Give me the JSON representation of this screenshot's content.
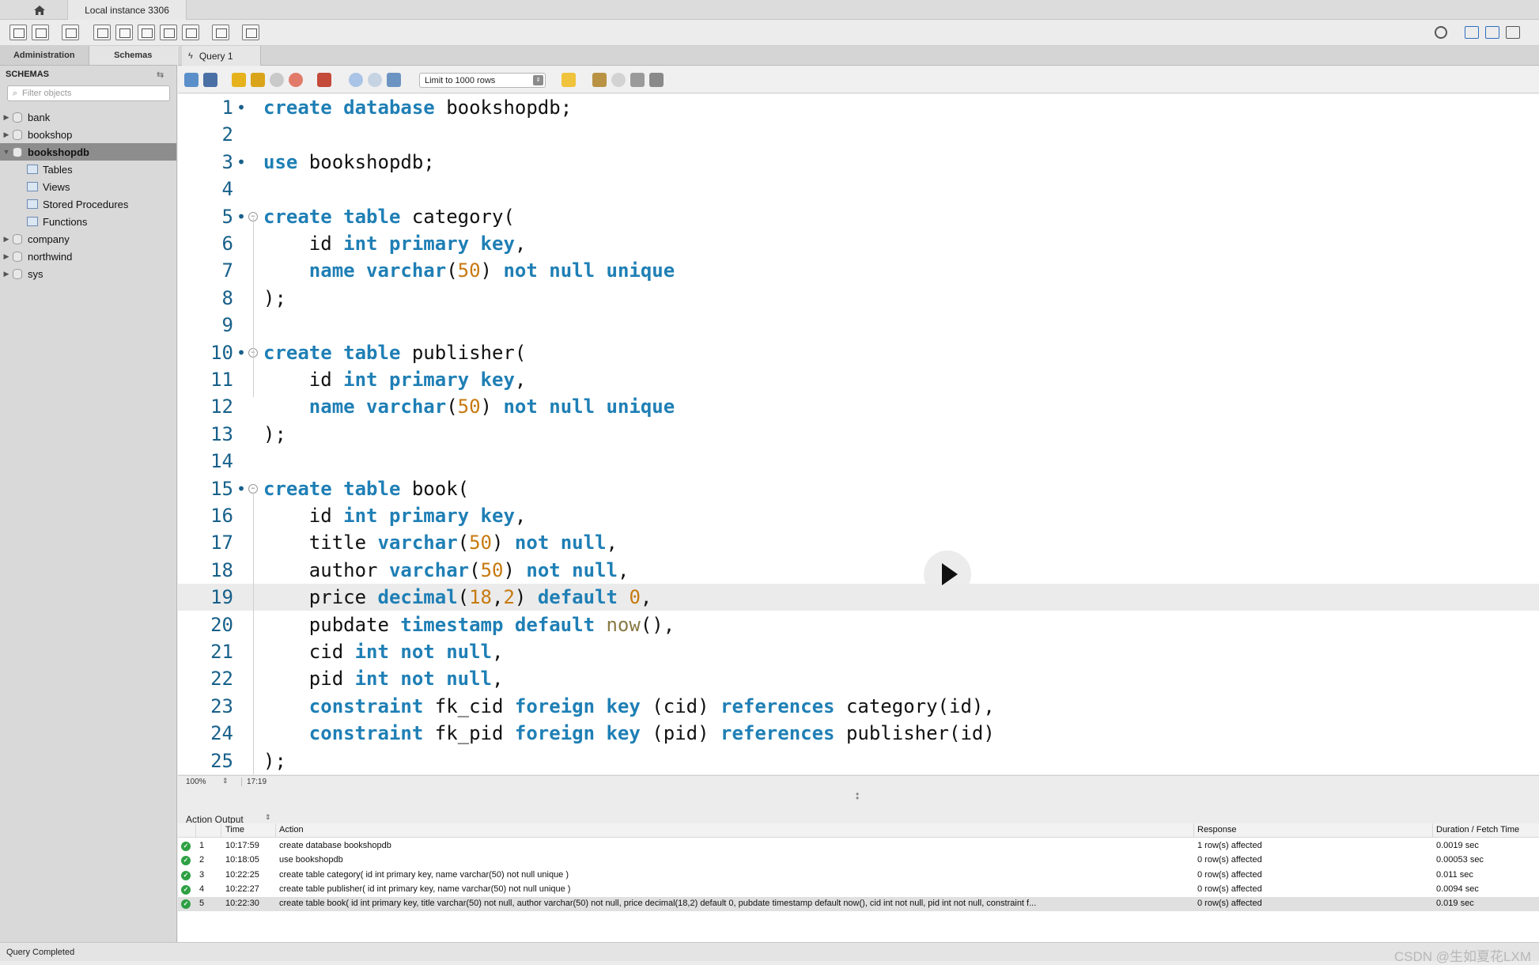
{
  "window": {
    "connection_tab": "Local instance 3306"
  },
  "sidebar": {
    "tabs": [
      "Administration",
      "Schemas"
    ],
    "header": "SCHEMAS",
    "filter_placeholder": "Filter objects",
    "schemas": [
      {
        "name": "bank",
        "expanded": false,
        "selected": false
      },
      {
        "name": "bookshop",
        "expanded": false,
        "selected": false
      },
      {
        "name": "bookshopdb",
        "expanded": true,
        "selected": true,
        "children": [
          "Tables",
          "Views",
          "Stored Procedures",
          "Functions"
        ]
      },
      {
        "name": "company",
        "expanded": false,
        "selected": false
      },
      {
        "name": "northwind",
        "expanded": false,
        "selected": false
      },
      {
        "name": "sys",
        "expanded": false,
        "selected": false
      }
    ]
  },
  "query_tab": {
    "label": "Query 1"
  },
  "editor_toolbar": {
    "limit_select": "Limit to 1000 rows"
  },
  "editor": {
    "current_line": 19,
    "lines": [
      {
        "n": "1",
        "dot": true,
        "fold": false,
        "code": "<span class='kw'>create database</span> bookshopdb;"
      },
      {
        "n": "2",
        "dot": false,
        "fold": false,
        "code": ""
      },
      {
        "n": "3",
        "dot": true,
        "fold": false,
        "code": "<span class='kw'>use</span> bookshopdb;"
      },
      {
        "n": "4",
        "dot": false,
        "fold": false,
        "code": ""
      },
      {
        "n": "5",
        "dot": true,
        "fold": true,
        "code": "<span class='kw'>create table</span> category("
      },
      {
        "n": "6",
        "dot": false,
        "fold": false,
        "code": "    id <span class='kw'>int primary key</span>,"
      },
      {
        "n": "7",
        "dot": false,
        "fold": false,
        "code": "    <span class='kw'>name varchar</span>(<span class='num'>50</span>) <span class='kw'>not null unique</span>"
      },
      {
        "n": "8",
        "dot": false,
        "fold": false,
        "code": ");"
      },
      {
        "n": "9",
        "dot": false,
        "fold": false,
        "code": ""
      },
      {
        "n": "10",
        "dot": true,
        "fold": true,
        "code": "<span class='kw'>create table</span> publisher("
      },
      {
        "n": "11",
        "dot": false,
        "fold": false,
        "code": "    id <span class='kw'>int primary key</span>,"
      },
      {
        "n": "12",
        "dot": false,
        "fold": false,
        "code": "    <span class='kw'>name varchar</span>(<span class='num'>50</span>) <span class='kw'>not null unique</span>"
      },
      {
        "n": "13",
        "dot": false,
        "fold": false,
        "code": ");"
      },
      {
        "n": "14",
        "dot": false,
        "fold": false,
        "code": ""
      },
      {
        "n": "15",
        "dot": true,
        "fold": true,
        "code": "<span class='kw'>create table</span> book("
      },
      {
        "n": "16",
        "dot": false,
        "fold": false,
        "code": "    id <span class='kw'>int primary key</span>,"
      },
      {
        "n": "17",
        "dot": false,
        "fold": false,
        "code": "    title <span class='kw'>varchar</span>(<span class='num'>50</span>) <span class='kw'>not null</span>,"
      },
      {
        "n": "18",
        "dot": false,
        "fold": false,
        "code": "    author <span class='kw'>varchar</span>(<span class='num'>50</span>) <span class='kw'>not null</span>,"
      },
      {
        "n": "19",
        "dot": false,
        "fold": false,
        "code": "    price <span class='kw'>decimal</span>(<span class='num'>18</span>,<span class='num'>2</span>) <span class='kw'>default</span> <span class='num'>0</span>,"
      },
      {
        "n": "20",
        "dot": false,
        "fold": false,
        "code": "    pubdate <span class='kw'>timestamp default</span> <span class='fn'>now</span>(),"
      },
      {
        "n": "21",
        "dot": false,
        "fold": false,
        "code": "    cid <span class='kw'>int not null</span>,"
      },
      {
        "n": "22",
        "dot": false,
        "fold": false,
        "code": "    pid <span class='kw'>int not null</span>,"
      },
      {
        "n": "23",
        "dot": false,
        "fold": false,
        "code": "    <span class='kw'>constraint</span> fk_cid <span class='kw'>foreign key</span> (cid) <span class='kw'>references</span> category(id),"
      },
      {
        "n": "24",
        "dot": false,
        "fold": false,
        "code": "    <span class='kw'>constraint</span> fk_pid <span class='kw'>foreign key</span> (pid) <span class='kw'>references</span> publisher(id)"
      },
      {
        "n": "25",
        "dot": false,
        "fold": false,
        "code": ");"
      }
    ]
  },
  "editor_status": {
    "zoom": "100%",
    "cursor": "17:19"
  },
  "output": {
    "title": "Action Output",
    "columns": [
      "",
      "Time",
      "Action",
      "Response",
      "Duration / Fetch Time"
    ],
    "rows": [
      {
        "n": "1",
        "time": "10:17:59",
        "action": "create database bookshopdb",
        "response": "1 row(s) affected",
        "duration": "0.0019 sec"
      },
      {
        "n": "2",
        "time": "10:18:05",
        "action": "use bookshopdb",
        "response": "0 row(s) affected",
        "duration": "0.00053 sec"
      },
      {
        "n": "3",
        "time": "10:22:25",
        "action": "create table category(  id int primary key,     name varchar(50) not null unique )",
        "response": "0 row(s) affected",
        "duration": "0.011 sec"
      },
      {
        "n": "4",
        "time": "10:22:27",
        "action": "create table publisher(  id int primary key,     name varchar(50) not null unique )",
        "response": "0 row(s) affected",
        "duration": "0.0094 sec"
      },
      {
        "n": "5",
        "time": "10:22:30",
        "action": "create table book(  id int primary key,     title varchar(50) not null,     author varchar(50) not null,     price decimal(18,2) default 0,     pubdate timestamp default now(),     cid int not null,     pid int not null,     constraint f...",
        "response": "0 row(s) affected",
        "duration": "0.019 sec"
      }
    ]
  },
  "statusbar": {
    "text": "Query Completed",
    "watermark": "CSDN @生如夏花LXM"
  }
}
